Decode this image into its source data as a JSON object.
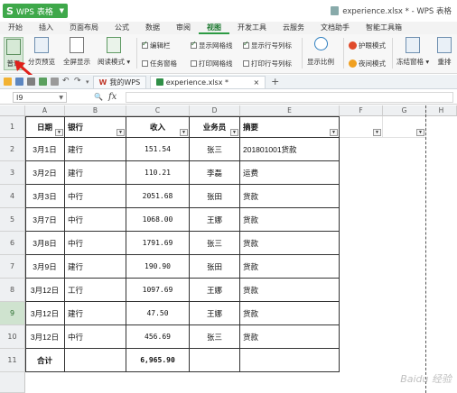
{
  "titlebar": {
    "app_logo": "S",
    "app_name": "WPS 表格",
    "doc_title": "experience.xlsx * - WPS 表格"
  },
  "menu": {
    "tabs": [
      "开始",
      "插入",
      "页面布局",
      "公式",
      "数据",
      "审阅",
      "视图",
      "开发工具",
      "云服务",
      "文档助手",
      "智能工具箱"
    ],
    "active": "视图"
  },
  "ribbon": {
    "normal": "普通",
    "page_break_preview": "分页预览",
    "full_screen": "全屏显示",
    "reading_mode": "阅读模式",
    "edit_bar": "编辑栏",
    "show_gridlines": "显示网格线",
    "show_row_col_headers": "显示行号列标",
    "task_pane": "任务窗格",
    "print_gridlines": "打印网格线",
    "print_row_col_headers": "打印行号列标",
    "display_ratio": "显示比例",
    "eye_protection": "护眼模式",
    "night_mode": "夜间模式",
    "freeze_panes": "冻结窗格",
    "rearrange": "重排"
  },
  "quickbar": {
    "tab_mywps": "我的WPS",
    "tab_doc": "experience.xlsx *",
    "close": "×",
    "add": "+"
  },
  "formula_bar": {
    "cell_ref": "I9",
    "fx": "fx",
    "value": ""
  },
  "sheet": {
    "columns": [
      "A",
      "B",
      "C",
      "D",
      "E",
      "F",
      "G",
      "H"
    ],
    "row_numbers": [
      "1",
      "2",
      "3",
      "4",
      "5",
      "6",
      "7",
      "8",
      "9",
      "10",
      "11"
    ],
    "selected_row": "9",
    "headers": [
      "日期",
      "银行",
      "收入",
      "业务员",
      "摘要"
    ],
    "rows": [
      [
        "3月1日",
        "建行",
        "151.54",
        "张三",
        "201801001货款"
      ],
      [
        "3月2日",
        "建行",
        "110.21",
        "李磊",
        "运费"
      ],
      [
        "3月3日",
        "中行",
        "2051.68",
        "张田",
        "货款"
      ],
      [
        "3月7日",
        "中行",
        "1068.00",
        "王娜",
        "货款"
      ],
      [
        "3月8日",
        "中行",
        "1791.69",
        "张三",
        "货款"
      ],
      [
        "3月9日",
        "建行",
        "190.90",
        "张田",
        "货款"
      ],
      [
        "3月12日",
        "工行",
        "1097.69",
        "王娜",
        "货款"
      ],
      [
        "3月12日",
        "建行",
        "47.50",
        "王娜",
        "货款"
      ],
      [
        "3月12日",
        "中行",
        "456.69",
        "张三",
        "货款"
      ]
    ],
    "total_label": "合计",
    "total_value": "6,965.90"
  },
  "watermark": "Baidu 经验"
}
